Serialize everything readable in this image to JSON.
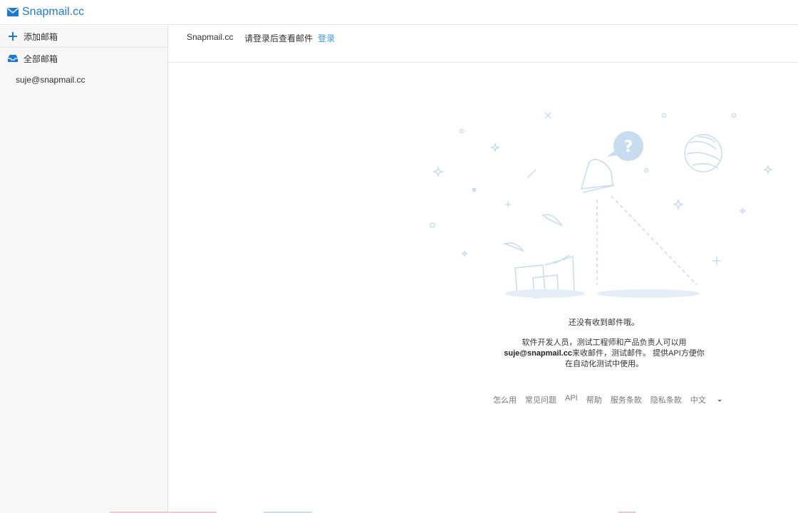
{
  "brand": {
    "name": "Snapmail.cc",
    "icon": "envelope-icon",
    "color": "#1a7bd4"
  },
  "sidebar": {
    "add_label": "添加邮箱",
    "all_label": "全部邮箱",
    "mailboxes": [
      "suje@snapmail.cc"
    ]
  },
  "header": {
    "site": "Snapmail.cc",
    "message": "请登录后查看邮件",
    "login": "登录"
  },
  "empty": {
    "title": "还没有收到邮件哦。",
    "desc_line1": "软件开发人员，测试工程师和产品负责人可以用",
    "email": "suje@snapmail.cc",
    "desc_line2_rest": "来收邮件，测试邮件。 提供API方便你",
    "desc_line3": "在自动化测试中使用。"
  },
  "footer": {
    "how": "怎么用",
    "faq": "常见问题",
    "api": "API",
    "help": "帮助",
    "terms": "服务条款",
    "privacy": "隐私条款",
    "lang": "中文"
  },
  "colors": {
    "accent": "#1a7bd4",
    "link": "#3a9ae0",
    "illustration": "#c8dcf0"
  }
}
